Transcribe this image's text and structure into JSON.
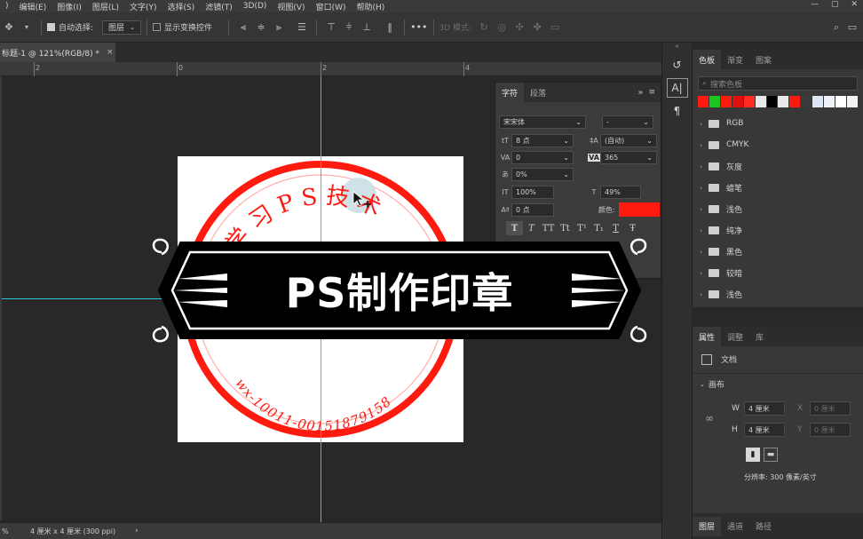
{
  "menubar": {
    "items": [
      ")",
      "编辑(E)",
      "图像(I)",
      "图层(L)",
      "文字(Y)",
      "选择(S)",
      "滤镜(T)",
      "3D(D)",
      "视图(V)",
      "窗口(W)",
      "帮助(H)"
    ]
  },
  "optionsbar": {
    "auto_select_label": "自动选择:",
    "auto_select_target": "图层",
    "show_transform_label": "显示变换控件",
    "mode_3d_label": "3D 模式:",
    "more_label": "•••"
  },
  "document": {
    "tab_title": "标题-1 @ 121%(RGB/8) *",
    "ruler_numbers": [
      "2",
      "0",
      "2",
      "4"
    ]
  },
  "character_panel": {
    "tab_character": "字符",
    "tab_paragraph": "段落",
    "font_family": "宋宋体",
    "font_style": "-",
    "font_size": "8 点",
    "leading": "(自动)",
    "kerning": "0",
    "tracking": "365",
    "tsume": "0%",
    "vertical_scale": "100%",
    "horizontal_scale": "49%",
    "baseline_shift": "0 点",
    "color_label": "颜色:",
    "color_value": "#ff1a10",
    "style_buttons": [
      "T",
      "T",
      "TT",
      "Tt",
      "T¹",
      "T₁",
      "T",
      "Ŧ"
    ]
  },
  "swatches_panel": {
    "tabs": [
      "色板",
      "渐变",
      "图案"
    ],
    "search_placeholder": "搜索色板",
    "swatch_colors": [
      "#ff1a10",
      "#1ec41e",
      "#ff1a10",
      "#e01010",
      "#ff2a20",
      "#e8e8e8",
      "#000000",
      "#e8e8e8",
      "#ff1a10",
      "#3a3a3a",
      "#dde6f2",
      "#eef2f8",
      "#ffffff",
      "#f4f4f4"
    ],
    "folders": [
      "RGB",
      "CMYK",
      "灰度",
      "蜡笔",
      "浅色",
      "纯净",
      "黑色",
      "较暗",
      "浅色"
    ]
  },
  "properties_panel": {
    "tabs": [
      "属性",
      "调整",
      "库"
    ],
    "doc_label": "文档",
    "canvas_label": "画布",
    "w_label": "W",
    "w_value": "4 厘米",
    "h_label": "H",
    "h_value": "4 厘米",
    "x_label": "X",
    "x_value": "0 厘米",
    "y_label": "Y",
    "y_value": "0 厘米",
    "resolution": "分辨率: 300 像素/英寸"
  },
  "layers_panel": {
    "tabs": [
      "图层",
      "通道",
      "路径"
    ]
  },
  "statusbar": {
    "zoom": "%",
    "doc_size": "4 厘米 x 4 厘米 (300 ppi)"
  },
  "stamp": {
    "top_text": "5交流学习PS技术",
    "bottom_text": "wx-10011-00151879158",
    "color": "#ff1a10"
  },
  "banner": {
    "title": "PS制作印章"
  }
}
